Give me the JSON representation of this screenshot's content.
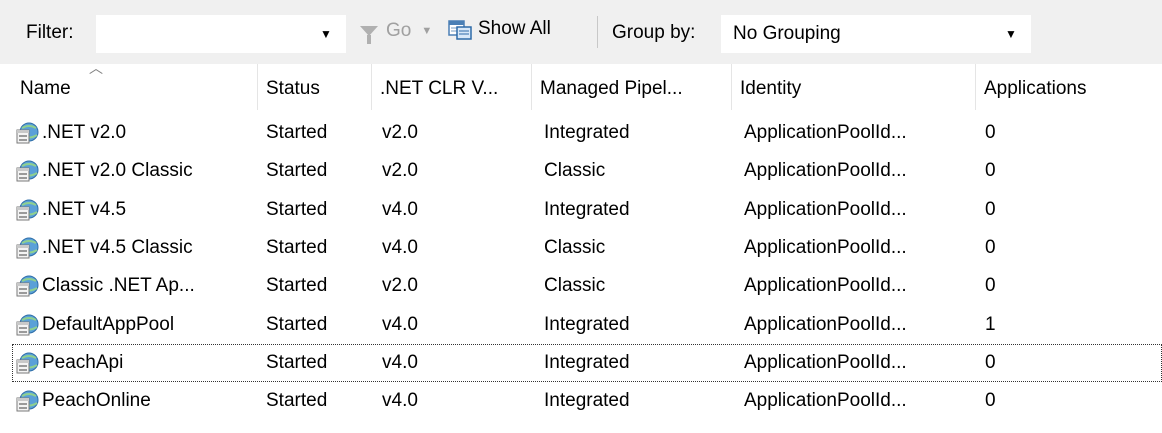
{
  "toolbar": {
    "filter_label": "Filter:",
    "filter_value": "",
    "go_label": "Go",
    "show_all_label": "Show All",
    "group_by_label": "Group by:",
    "group_by_value": "No Grouping"
  },
  "columns": [
    {
      "label": "Name"
    },
    {
      "label": "Status"
    },
    {
      "label": ".NET CLR V..."
    },
    {
      "label": "Managed Pipel..."
    },
    {
      "label": "Identity"
    },
    {
      "label": "Applications"
    }
  ],
  "rows": [
    {
      "name": ".NET v2.0",
      "status": "Started",
      "clr": "v2.0",
      "pipeline": "Integrated",
      "identity": "ApplicationPoolId...",
      "apps": "0"
    },
    {
      "name": ".NET v2.0 Classic",
      "status": "Started",
      "clr": "v2.0",
      "pipeline": "Classic",
      "identity": "ApplicationPoolId...",
      "apps": "0"
    },
    {
      "name": ".NET v4.5",
      "status": "Started",
      "clr": "v4.0",
      "pipeline": "Integrated",
      "identity": "ApplicationPoolId...",
      "apps": "0"
    },
    {
      "name": ".NET v4.5 Classic",
      "status": "Started",
      "clr": "v4.0",
      "pipeline": "Classic",
      "identity": "ApplicationPoolId...",
      "apps": "0"
    },
    {
      "name": "Classic .NET Ap...",
      "status": "Started",
      "clr": "v2.0",
      "pipeline": "Classic",
      "identity": "ApplicationPoolId...",
      "apps": "0"
    },
    {
      "name": "DefaultAppPool",
      "status": "Started",
      "clr": "v4.0",
      "pipeline": "Integrated",
      "identity": "ApplicationPoolId...",
      "apps": "1"
    },
    {
      "name": "PeachApi",
      "status": "Started",
      "clr": "v4.0",
      "pipeline": "Integrated",
      "identity": "ApplicationPoolId...",
      "apps": "0"
    },
    {
      "name": "PeachOnline",
      "status": "Started",
      "clr": "v4.0",
      "pipeline": "Integrated",
      "identity": "ApplicationPoolId...",
      "apps": "0"
    }
  ],
  "icons": {
    "row_icon": "application-pool-icon",
    "show_all_icon": "show-all-icon",
    "go_icon": "filter-funnel-icon"
  },
  "colors": {
    "toolbar_bg": "#f0f0f0",
    "disabled_text": "#a0a0a0"
  }
}
